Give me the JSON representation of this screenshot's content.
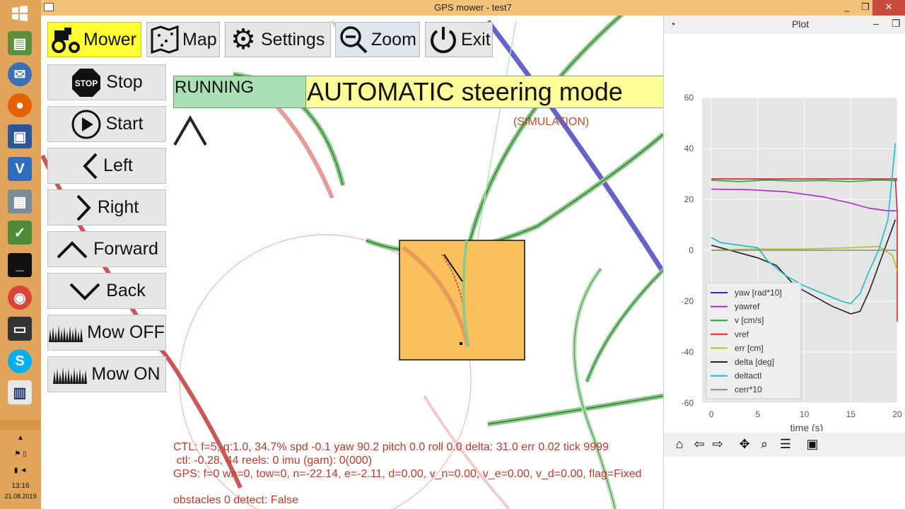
{
  "window": {
    "title": "GPS mower - test7",
    "minimize": "_",
    "restore": "❐",
    "close": "✕"
  },
  "toolbar": {
    "mower_label": "Mower",
    "map_label": "Map",
    "settings_label": "Settings",
    "zoom_label": "Zoom",
    "exit_label": "Exit"
  },
  "side_buttons": {
    "stop": "Stop",
    "stop_icon_text": "STOP",
    "start": "Start",
    "left": "Left",
    "right": "Right",
    "forward": "Forward",
    "back": "Back",
    "mow_off": "Mow OFF",
    "mow_on": "Mow ON"
  },
  "status": {
    "running": "RUNNING",
    "mode": "AUTOMATIC steering mode",
    "simulation": "(SIMULATION)"
  },
  "console": {
    "ctl_line": "CTL: f=5, q:1.0, 34.7% spd -0.1 yaw 90.2 pitch 0.0 roll 0.0 delta: 31.0 err 0.02 tick 9999",
    "ctl2_line": " ctl: -0.28, 44 reels: 0 imu (gam): 0(000)",
    "gps_line": "GPS: f=0 wn=0, tow=0, n=-22.14, e=-2.11, d=0.00, v_n=0.00, v_e=0.00, v_d=0.00, flag=Fixed",
    "obstacles_line": "obstacles 0 detect: False"
  },
  "taskbar": {
    "time": "13:16",
    "date": "21.08.2019"
  },
  "plot_window": {
    "title": "Plot",
    "minimize": "–",
    "close": "❐"
  },
  "chart_data": {
    "type": "line",
    "xlabel": "time (s)",
    "ylabel": "",
    "xlim": [
      -1,
      20
    ],
    "ylim": [
      -60,
      60
    ],
    "xticks": [
      0,
      5,
      10,
      15,
      20
    ],
    "yticks": [
      -60,
      -40,
      -20,
      0,
      20,
      40,
      60
    ],
    "legend_position": "lower-left",
    "grid": true,
    "series": [
      {
        "name": "yaw [rad*10]",
        "color": "#2a2ad0",
        "x": [
          0,
          20
        ],
        "y": [
          28,
          28
        ]
      },
      {
        "name": "yawref",
        "color": "#b026c7",
        "x": [
          0,
          4,
          8,
          12,
          15,
          17,
          19,
          20
        ],
        "y": [
          24,
          23.8,
          23,
          21,
          18.5,
          16.5,
          15.5,
          15.5
        ]
      },
      {
        "name": "v [cm/s]",
        "color": "#2ca02c",
        "x": [
          0,
          3,
          6,
          9,
          12,
          15,
          18,
          20
        ],
        "y": [
          27.5,
          27,
          27.6,
          27.2,
          27.4,
          27,
          27.6,
          27.3
        ]
      },
      {
        "name": "vref",
        "color": "#d62728",
        "x": [
          0,
          19.8,
          20,
          20
        ],
        "y": [
          28,
          28,
          15,
          -28
        ]
      },
      {
        "name": "err [cm]",
        "color": "#bcbd22",
        "x": [
          0,
          5,
          10,
          15,
          18,
          19.5,
          20
        ],
        "y": [
          0,
          0.5,
          0.5,
          1,
          1.5,
          -2,
          -8
        ]
      },
      {
        "name": "delta [deg]",
        "color": "#222222",
        "x": [
          0,
          2,
          5,
          7,
          9,
          11,
          13,
          15,
          16,
          17,
          18,
          19,
          19.8
        ],
        "y": [
          2,
          0,
          -3,
          -6,
          -14,
          -18,
          -22,
          -25,
          -24,
          -16,
          -6,
          4,
          12
        ]
      },
      {
        "name": "deltactl",
        "color": "#17becf",
        "x": [
          0,
          1,
          3,
          5,
          6,
          8,
          10,
          12,
          14,
          15,
          16,
          17,
          18,
          19,
          19.8
        ],
        "y": [
          5,
          3,
          2,
          1,
          -4,
          -10,
          -14,
          -17,
          -20,
          -21,
          -17,
          -8,
          0,
          12,
          42
        ]
      },
      {
        "name": "cerr*10",
        "color": "#888888",
        "x": [
          0,
          20
        ],
        "y": [
          0,
          0
        ]
      }
    ]
  }
}
